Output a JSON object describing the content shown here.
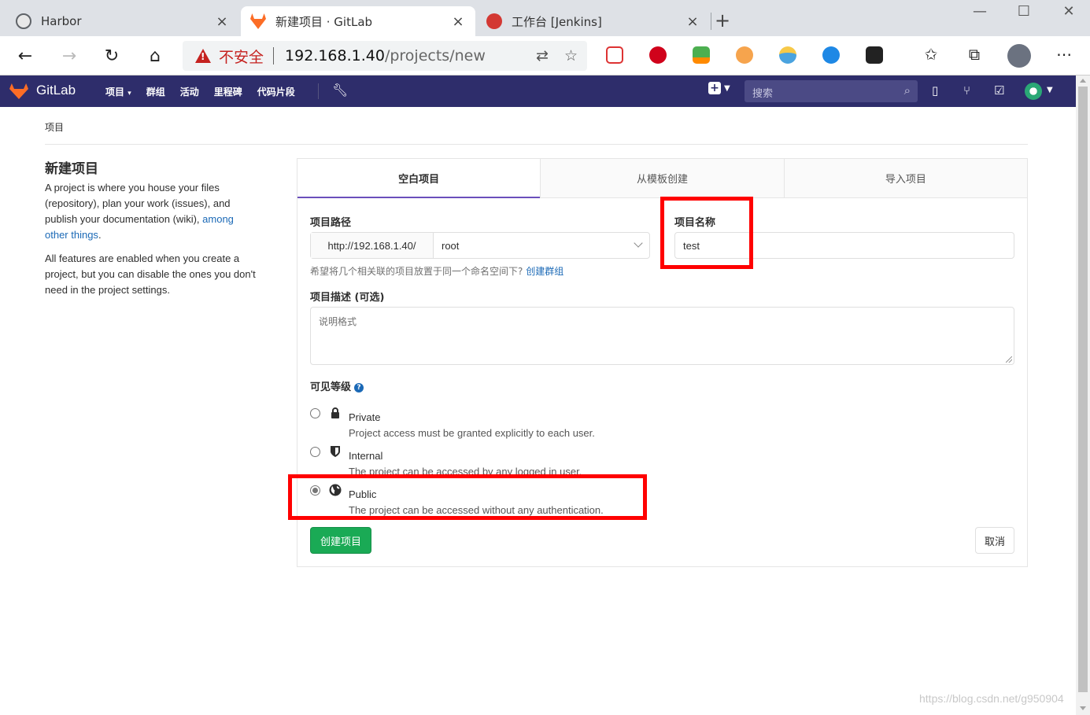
{
  "browser": {
    "tabs": [
      {
        "title": "Harbor"
      },
      {
        "title": "新建项目 · GitLab"
      },
      {
        "title": "工作台 [Jenkins]"
      }
    ],
    "security_label": "不安全",
    "url_host": "192.168.1.40",
    "url_path": "/projects/new"
  },
  "gitlab_nav": {
    "brand": "GitLab",
    "menu": [
      "项目",
      "群组",
      "活动",
      "里程碑",
      "代码片段"
    ],
    "search_placeholder": "搜索"
  },
  "breadcrumb": "项目",
  "sidebar": {
    "title": "新建项目",
    "para1_text": "A project is where you house your files (repository), plan your work (issues), and publish your documentation (wiki), ",
    "para1_link": "among other things",
    "para1_end": ".",
    "para2": "All features are enabled when you create a project, but you can disable the ones you don't need in the project settings."
  },
  "tabs": [
    "空白项目",
    "从模板创建",
    "导入项目"
  ],
  "form": {
    "path_label": "项目路径",
    "path_prefix": "http://192.168.1.40/",
    "namespace": "root",
    "name_label": "项目名称",
    "name_value": "test",
    "hint_text": "希望将几个相关联的项目放置于同一个命名空间下?",
    "hint_link": "创建群组",
    "desc_label": "项目描述 (可选)",
    "desc_placeholder": "说明格式",
    "visibility_label": "可见等级",
    "visibility": [
      {
        "title": "Private",
        "desc": "Project access must be granted explicitly to each user.",
        "icon": "lock-icon",
        "checked": false
      },
      {
        "title": "Internal",
        "desc": "The project can be accessed by any logged in user.",
        "icon": "shield-icon",
        "checked": false
      },
      {
        "title": "Public",
        "desc": "The project can be accessed without any authentication.",
        "icon": "globe-icon",
        "checked": true
      }
    ],
    "create_label": "创建项目",
    "cancel_label": "取消"
  },
  "watermark": "https://blog.csdn.net/g950904",
  "colors": {
    "gitlab_nav": "#2e2d6b",
    "create_button": "#1aaa55",
    "highlight": "#ff0000",
    "active_tab_border": "#6b4fbb"
  }
}
